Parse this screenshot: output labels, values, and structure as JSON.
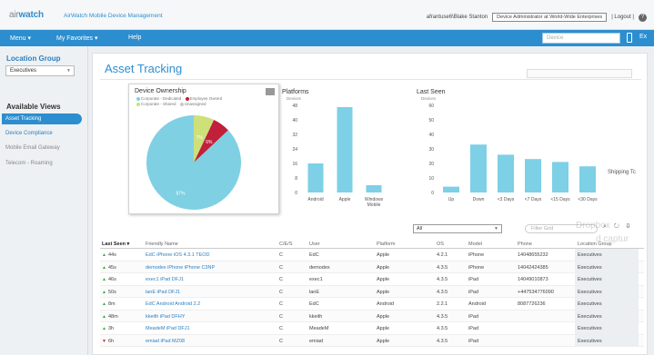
{
  "header": {
    "logo_brand": "air",
    "logo_rest": "watch",
    "app_title": "AirWatch Mobile Device Management",
    "user": "afrantuse6\\Blake Stanton",
    "role_select": "Device Administrator at World-Wide Enterprises",
    "logout": "| Logout |",
    "help_icon": "?"
  },
  "nav": {
    "menu": "Menu ▾",
    "favorites": "My Favorites ▾",
    "help": "Help",
    "search_placeholder": "Device",
    "extra": "Ex"
  },
  "sidebar": {
    "location_group_title": "Location Group",
    "location_group_value": "Executives",
    "available_views_title": "Available Views",
    "items": [
      {
        "label": "Asset Tracking"
      },
      {
        "label": "Device Compliance"
      },
      {
        "label": "Mobile Email Gateway"
      },
      {
        "label": "Telecom - Roaming"
      }
    ]
  },
  "main": {
    "title": "Asset Tracking"
  },
  "ownership": {
    "title": "Device Ownership",
    "legend": [
      {
        "label": "Corporate - Dedicated",
        "color": "#7fd0e3"
      },
      {
        "label": "Employee Owned",
        "color": "#c0203a"
      },
      {
        "label": "Corporate - Shared",
        "color": "#cde07a"
      },
      {
        "label": "Unassigned",
        "color": "#c8c8c8"
      }
    ]
  },
  "chart_data": [
    {
      "type": "pie",
      "title": "Device Ownership",
      "labels": [
        "Corporate - Dedicated",
        "Employee Owned",
        "Corporate - Shared",
        "Unassigned"
      ],
      "values": [
        87,
        6,
        7,
        0
      ],
      "slice_labels": [
        "87%",
        "6%",
        "7%",
        ""
      ],
      "colors": [
        "#7fd0e3",
        "#c0203a",
        "#cde07a",
        "#c8c8c8"
      ]
    },
    {
      "type": "bar",
      "title": "Platforms",
      "legend": "Devices",
      "categories": [
        "Android",
        "Apple",
        "Windows\nMobile"
      ],
      "values": [
        16,
        47,
        4
      ],
      "yticks": [
        0,
        8,
        16,
        24,
        32,
        40,
        48
      ],
      "ylim": [
        0,
        48
      ],
      "color": "#7dd0e6"
    },
    {
      "type": "bar",
      "title": "Last Seen",
      "legend": "Devices",
      "categories": [
        "Up",
        "Down",
        "<3 Days",
        "<7 Days",
        "<15 Days",
        "<30 Days"
      ],
      "values": [
        4,
        33,
        26,
        23,
        21,
        18
      ],
      "yticks": [
        0,
        10,
        20,
        30,
        40,
        50,
        60
      ],
      "ylim": [
        0,
        60
      ],
      "color": "#7dd0e6"
    }
  ],
  "table": {
    "filter_value": "All",
    "search_placeholder": "Filter Grid",
    "tools": "⌕ ↻ ⇩",
    "columns": [
      "Last Seen ▾",
      "Friendly Name",
      "C/E/S",
      "User",
      "Platform",
      "OS",
      "Model",
      "Phone",
      "Location Group"
    ],
    "rows": [
      {
        "status": "up",
        "last_seen": "44s",
        "name": "EdC iPhone iOS 4.3.1 TEOD",
        "ces": "C",
        "user": "EdC",
        "platform": "Apple",
        "os": "4.2.1",
        "model": "iPhone",
        "phone": "14048655232",
        "group": "Executives"
      },
      {
        "status": "up",
        "last_seen": "45s",
        "name": "demodex iPhone iPhone C3NP",
        "ces": "C",
        "user": "demodex",
        "platform": "Apple",
        "os": "4.3.5",
        "model": "iPhone",
        "phone": "14042424385",
        "group": "Executives"
      },
      {
        "status": "up",
        "last_seen": "46s",
        "name": "exec1 iPad DFJ1",
        "ces": "C",
        "user": "exec1",
        "platform": "Apple",
        "os": "4.3.5",
        "model": "iPad",
        "phone": "14049010873",
        "group": "Executives"
      },
      {
        "status": "up",
        "last_seen": "50s",
        "name": "lanE iPad DFJ1",
        "ces": "C",
        "user": "lanE",
        "platform": "Apple",
        "os": "4.3.5",
        "model": "iPad",
        "phone": "+447534776090",
        "group": "Executives"
      },
      {
        "status": "up",
        "last_seen": "8m",
        "name": "EdC Android Android 2.2",
        "ces": "C",
        "user": "EdC",
        "platform": "Android",
        "os": "2.2.1",
        "model": "Android",
        "phone": "8087726236",
        "group": "Executives"
      },
      {
        "status": "up",
        "last_seen": "48m",
        "name": "kkeith iPad DFHY",
        "ces": "C",
        "user": "kkeith",
        "platform": "Apple",
        "os": "4.3.5",
        "model": "iPad",
        "phone": "",
        "group": "Executives"
      },
      {
        "status": "up",
        "last_seen": "3h",
        "name": "MeadeM iPad DFJ1",
        "ces": "C",
        "user": "MeadeM",
        "platform": "Apple",
        "os": "4.3.5",
        "model": "iPad",
        "phone": "",
        "group": "Executives"
      },
      {
        "status": "down",
        "last_seen": "6h",
        "name": "emiad iPad MZ08",
        "ces": "C",
        "user": "emiad",
        "platform": "Apple",
        "os": "4.3.5",
        "model": "iPad",
        "phone": "",
        "group": "Executives"
      }
    ]
  },
  "overlays": {
    "hint": "Shipping Tc",
    "watermark1": "Dropbox",
    "watermark2": "d captur"
  },
  "colors": {
    "brand_blue": "#2c8ecf",
    "bar": "#7dd0e6",
    "up_arrow": "#2eaa3e",
    "down_arrow": "#c62828"
  }
}
